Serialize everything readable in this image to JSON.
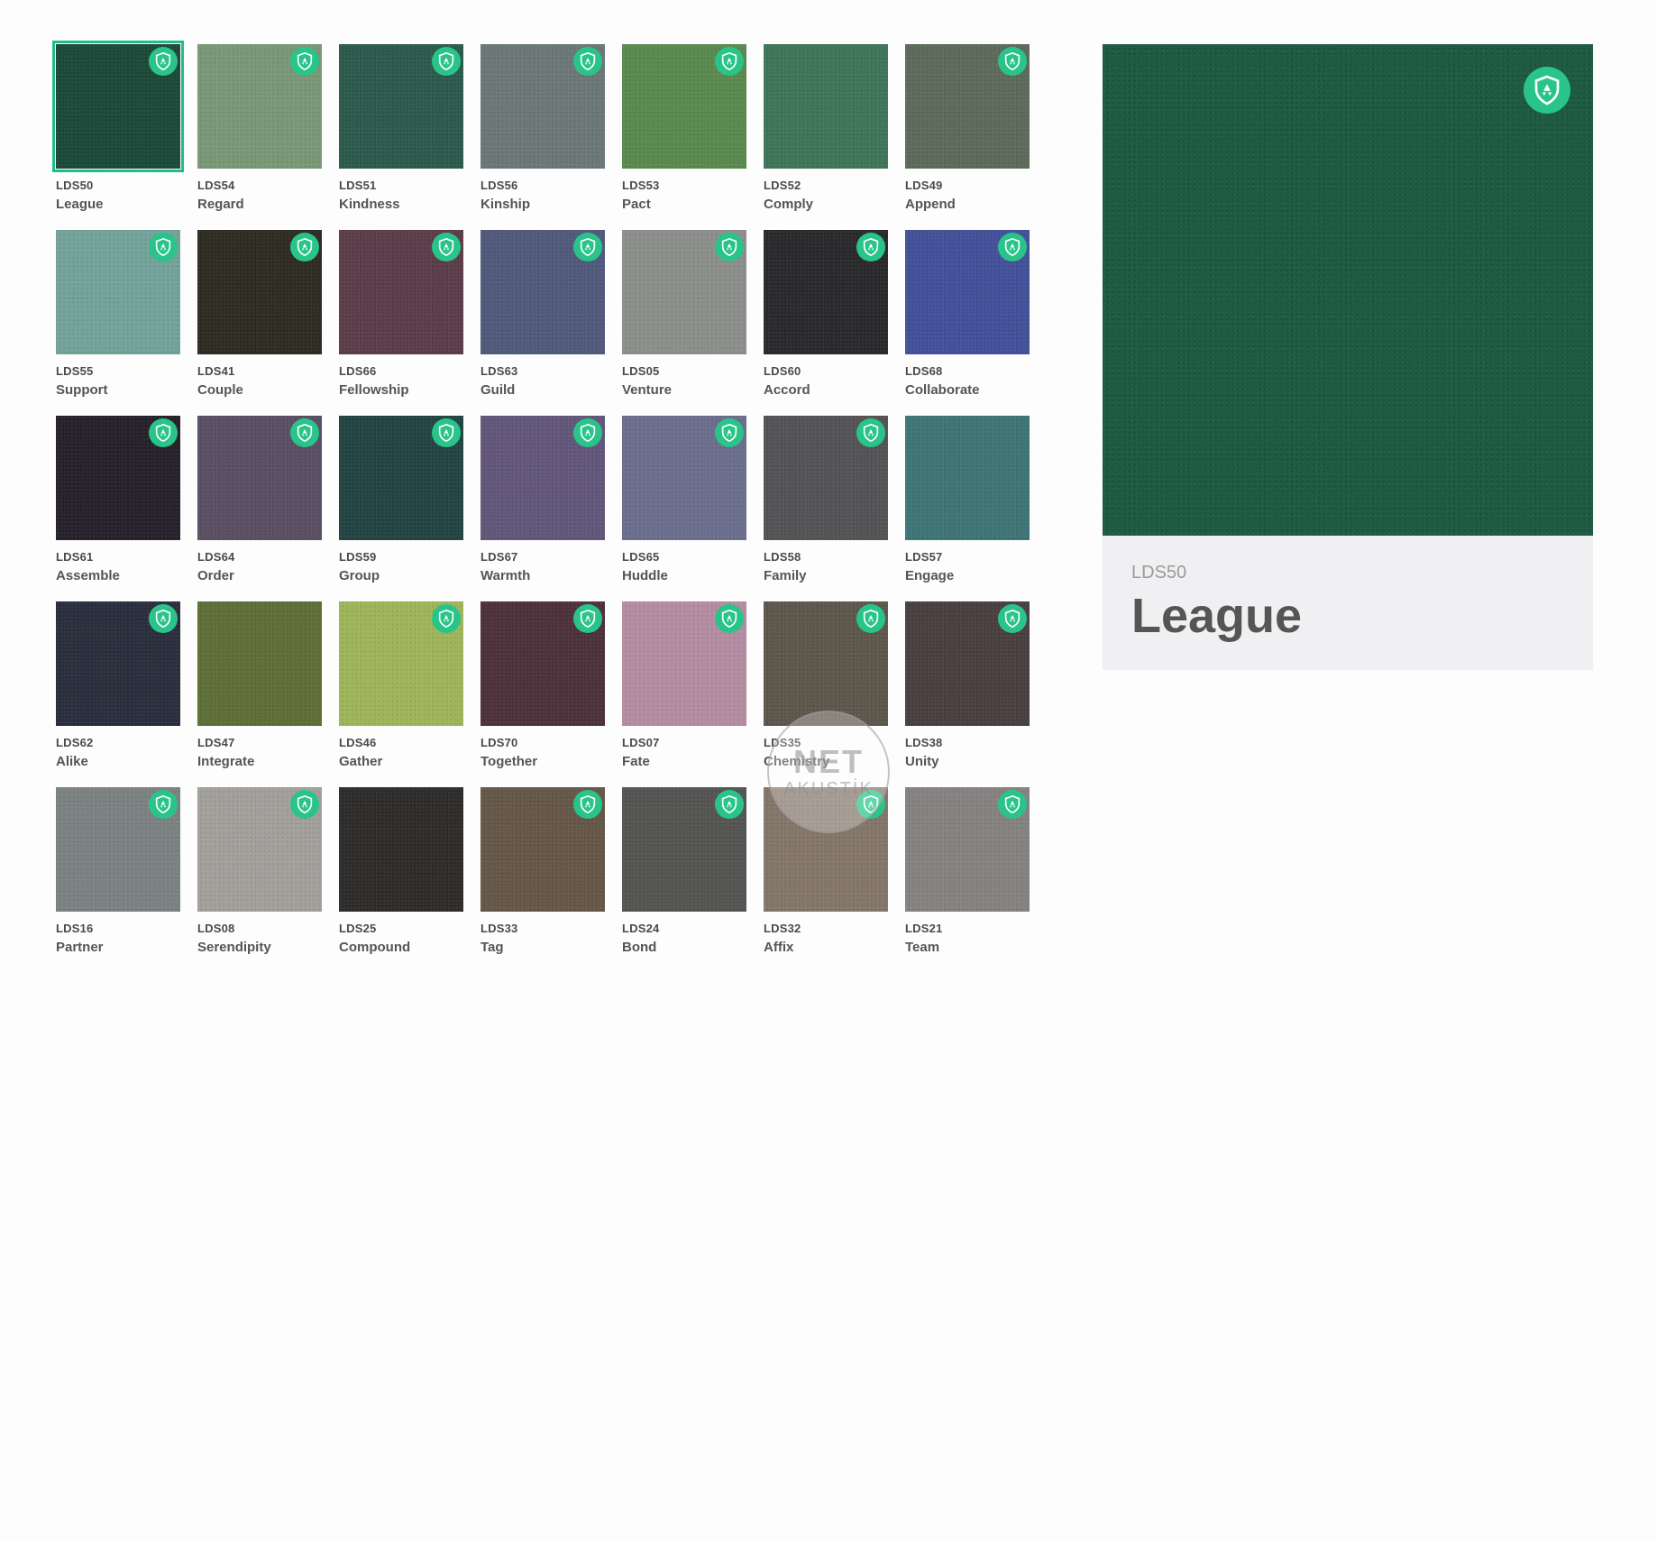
{
  "swatches": [
    {
      "code": "LDS50",
      "name": "League",
      "color": "#1c4a3a",
      "certified": true,
      "selected": true
    },
    {
      "code": "LDS54",
      "name": "Regard",
      "color": "#7a9877",
      "certified": true
    },
    {
      "code": "LDS51",
      "name": "Kindness",
      "color": "#2c5b4d",
      "certified": true
    },
    {
      "code": "LDS56",
      "name": "Kinship",
      "color": "#6b7877",
      "certified": true
    },
    {
      "code": "LDS53",
      "name": "Pact",
      "color": "#5a8a4f",
      "certified": true
    },
    {
      "code": "LDS52",
      "name": "Comply",
      "color": "#3f7659",
      "certified": false
    },
    {
      "code": "LDS49",
      "name": "Append",
      "color": "#5d6b5b",
      "certified": true
    },
    {
      "code": "LDS55",
      "name": "Support",
      "color": "#74a39b",
      "certified": true
    },
    {
      "code": "LDS41",
      "name": "Couple",
      "color": "#2e2c23",
      "certified": true
    },
    {
      "code": "LDS66",
      "name": "Fellowship",
      "color": "#5b3e4a",
      "certified": true
    },
    {
      "code": "LDS63",
      "name": "Guild",
      "color": "#525a7c",
      "certified": true
    },
    {
      "code": "LDS05",
      "name": "Venture",
      "color": "#8d8f8d",
      "certified": true
    },
    {
      "code": "LDS60",
      "name": "Accord",
      "color": "#2a2a2d",
      "certified": true
    },
    {
      "code": "LDS68",
      "name": "Collaborate",
      "color": "#44519a",
      "certified": true
    },
    {
      "code": "LDS61",
      "name": "Assemble",
      "color": "#26212a",
      "certified": true
    },
    {
      "code": "LDS64",
      "name": "Order",
      "color": "#5a4f63",
      "certified": true
    },
    {
      "code": "LDS59",
      "name": "Group",
      "color": "#244444",
      "certified": true
    },
    {
      "code": "LDS67",
      "name": "Warmth",
      "color": "#62577a",
      "certified": true
    },
    {
      "code": "LDS65",
      "name": "Huddle",
      "color": "#6b6e8c",
      "certified": true
    },
    {
      "code": "LDS58",
      "name": "Family",
      "color": "#545456",
      "certified": true
    },
    {
      "code": "LDS57",
      "name": "Engage",
      "color": "#3f7576",
      "certified": false
    },
    {
      "code": "LDS62",
      "name": "Alike",
      "color": "#2b2e3d",
      "certified": true
    },
    {
      "code": "LDS47",
      "name": "Integrate",
      "color": "#5e7037",
      "certified": false
    },
    {
      "code": "LDS46",
      "name": "Gather",
      "color": "#9eb55a",
      "certified": true
    },
    {
      "code": "LDS70",
      "name": "Together",
      "color": "#4e323b",
      "certified": true
    },
    {
      "code": "LDS07",
      "name": "Fate",
      "color": "#b48da2",
      "certified": true
    },
    {
      "code": "LDS35",
      "name": "Chemistry",
      "color": "#5e574c",
      "certified": true
    },
    {
      "code": "LDS38",
      "name": "Unity",
      "color": "#4a3f41",
      "certified": true
    },
    {
      "code": "LDS16",
      "name": "Partner",
      "color": "#7c8282",
      "certified": true
    },
    {
      "code": "LDS08",
      "name": "Serendipity",
      "color": "#a3a09c",
      "certified": true
    },
    {
      "code": "LDS25",
      "name": "Compound",
      "color": "#2e2d2b",
      "certified": false
    },
    {
      "code": "LDS33",
      "name": "Tag",
      "color": "#665848",
      "certified": true
    },
    {
      "code": "LDS24",
      "name": "Bond",
      "color": "#555553",
      "certified": true
    },
    {
      "code": "LDS32",
      "name": "Affix",
      "color": "#85766a",
      "certified": true
    },
    {
      "code": "LDS21",
      "name": "Team",
      "color": "#868281",
      "certified": true
    }
  ],
  "detail": {
    "code": "LDS50",
    "name": "League",
    "color": "#1e5a42",
    "certified": true
  },
  "watermark": {
    "line1": "NET",
    "line2": "AKUSTİK"
  },
  "accent_color": "#29c489",
  "icons": {
    "badge": "certified-shield-icon"
  }
}
